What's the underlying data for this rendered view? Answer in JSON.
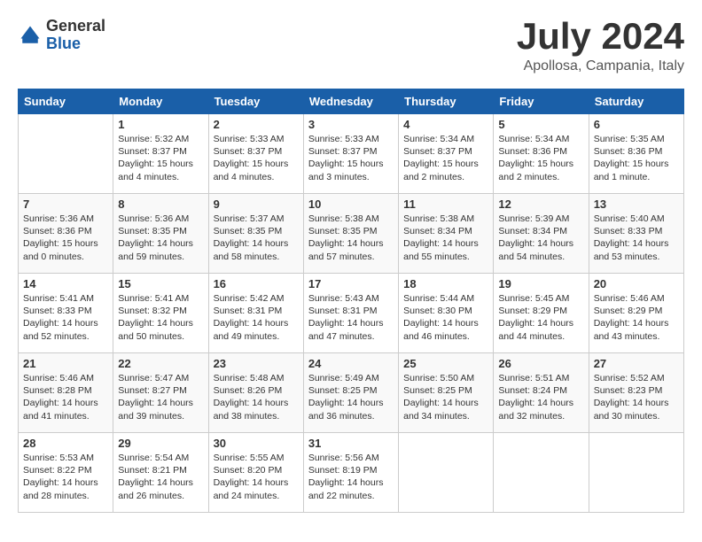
{
  "header": {
    "logo_general": "General",
    "logo_blue": "Blue",
    "month_title": "July 2024",
    "location": "Apollosa, Campania, Italy"
  },
  "calendar": {
    "columns": [
      "Sunday",
      "Monday",
      "Tuesday",
      "Wednesday",
      "Thursday",
      "Friday",
      "Saturday"
    ],
    "weeks": [
      [
        {
          "day": "",
          "content": ""
        },
        {
          "day": "1",
          "content": "Sunrise: 5:32 AM\nSunset: 8:37 PM\nDaylight: 15 hours\nand 4 minutes."
        },
        {
          "day": "2",
          "content": "Sunrise: 5:33 AM\nSunset: 8:37 PM\nDaylight: 15 hours\nand 4 minutes."
        },
        {
          "day": "3",
          "content": "Sunrise: 5:33 AM\nSunset: 8:37 PM\nDaylight: 15 hours\nand 3 minutes."
        },
        {
          "day": "4",
          "content": "Sunrise: 5:34 AM\nSunset: 8:37 PM\nDaylight: 15 hours\nand 2 minutes."
        },
        {
          "day": "5",
          "content": "Sunrise: 5:34 AM\nSunset: 8:36 PM\nDaylight: 15 hours\nand 2 minutes."
        },
        {
          "day": "6",
          "content": "Sunrise: 5:35 AM\nSunset: 8:36 PM\nDaylight: 15 hours\nand 1 minute."
        }
      ],
      [
        {
          "day": "7",
          "content": "Sunrise: 5:36 AM\nSunset: 8:36 PM\nDaylight: 15 hours\nand 0 minutes."
        },
        {
          "day": "8",
          "content": "Sunrise: 5:36 AM\nSunset: 8:35 PM\nDaylight: 14 hours\nand 59 minutes."
        },
        {
          "day": "9",
          "content": "Sunrise: 5:37 AM\nSunset: 8:35 PM\nDaylight: 14 hours\nand 58 minutes."
        },
        {
          "day": "10",
          "content": "Sunrise: 5:38 AM\nSunset: 8:35 PM\nDaylight: 14 hours\nand 57 minutes."
        },
        {
          "day": "11",
          "content": "Sunrise: 5:38 AM\nSunset: 8:34 PM\nDaylight: 14 hours\nand 55 minutes."
        },
        {
          "day": "12",
          "content": "Sunrise: 5:39 AM\nSunset: 8:34 PM\nDaylight: 14 hours\nand 54 minutes."
        },
        {
          "day": "13",
          "content": "Sunrise: 5:40 AM\nSunset: 8:33 PM\nDaylight: 14 hours\nand 53 minutes."
        }
      ],
      [
        {
          "day": "14",
          "content": "Sunrise: 5:41 AM\nSunset: 8:33 PM\nDaylight: 14 hours\nand 52 minutes."
        },
        {
          "day": "15",
          "content": "Sunrise: 5:41 AM\nSunset: 8:32 PM\nDaylight: 14 hours\nand 50 minutes."
        },
        {
          "day": "16",
          "content": "Sunrise: 5:42 AM\nSunset: 8:31 PM\nDaylight: 14 hours\nand 49 minutes."
        },
        {
          "day": "17",
          "content": "Sunrise: 5:43 AM\nSunset: 8:31 PM\nDaylight: 14 hours\nand 47 minutes."
        },
        {
          "day": "18",
          "content": "Sunrise: 5:44 AM\nSunset: 8:30 PM\nDaylight: 14 hours\nand 46 minutes."
        },
        {
          "day": "19",
          "content": "Sunrise: 5:45 AM\nSunset: 8:29 PM\nDaylight: 14 hours\nand 44 minutes."
        },
        {
          "day": "20",
          "content": "Sunrise: 5:46 AM\nSunset: 8:29 PM\nDaylight: 14 hours\nand 43 minutes."
        }
      ],
      [
        {
          "day": "21",
          "content": "Sunrise: 5:46 AM\nSunset: 8:28 PM\nDaylight: 14 hours\nand 41 minutes."
        },
        {
          "day": "22",
          "content": "Sunrise: 5:47 AM\nSunset: 8:27 PM\nDaylight: 14 hours\nand 39 minutes."
        },
        {
          "day": "23",
          "content": "Sunrise: 5:48 AM\nSunset: 8:26 PM\nDaylight: 14 hours\nand 38 minutes."
        },
        {
          "day": "24",
          "content": "Sunrise: 5:49 AM\nSunset: 8:25 PM\nDaylight: 14 hours\nand 36 minutes."
        },
        {
          "day": "25",
          "content": "Sunrise: 5:50 AM\nSunset: 8:25 PM\nDaylight: 14 hours\nand 34 minutes."
        },
        {
          "day": "26",
          "content": "Sunrise: 5:51 AM\nSunset: 8:24 PM\nDaylight: 14 hours\nand 32 minutes."
        },
        {
          "day": "27",
          "content": "Sunrise: 5:52 AM\nSunset: 8:23 PM\nDaylight: 14 hours\nand 30 minutes."
        }
      ],
      [
        {
          "day": "28",
          "content": "Sunrise: 5:53 AM\nSunset: 8:22 PM\nDaylight: 14 hours\nand 28 minutes."
        },
        {
          "day": "29",
          "content": "Sunrise: 5:54 AM\nSunset: 8:21 PM\nDaylight: 14 hours\nand 26 minutes."
        },
        {
          "day": "30",
          "content": "Sunrise: 5:55 AM\nSunset: 8:20 PM\nDaylight: 14 hours\nand 24 minutes."
        },
        {
          "day": "31",
          "content": "Sunrise: 5:56 AM\nSunset: 8:19 PM\nDaylight: 14 hours\nand 22 minutes."
        },
        {
          "day": "",
          "content": ""
        },
        {
          "day": "",
          "content": ""
        },
        {
          "day": "",
          "content": ""
        }
      ]
    ]
  }
}
